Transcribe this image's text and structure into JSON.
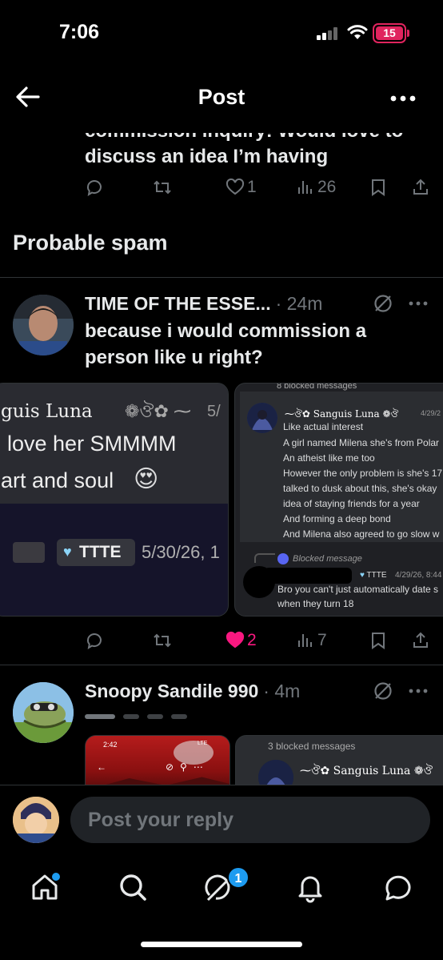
{
  "status": {
    "time": "7:06",
    "battery": "15"
  },
  "topbar": {
    "title": "Post"
  },
  "prev_post": {
    "text_line1": "commission inquiry! Would love to",
    "text_line2": "discuss an idea I’m having",
    "likes": "1",
    "views": "26"
  },
  "section": {
    "heading": "Probable spam"
  },
  "post1": {
    "name": "TIME OF THE ESSE...",
    "meta": "· 24m",
    "text_line1": "because i would commission a",
    "text_line2": "person like u right?",
    "likes": "2",
    "views": "7",
    "media1": {
      "user": "guis Luna",
      "user_suffix": "5/",
      "line1": "love her SMMMM",
      "line2": "art and soul",
      "tag": "TTTE",
      "date": "5/30/26, 1"
    },
    "media2": {
      "header": "8 blocked messages",
      "user": "Sanguis Luna",
      "date": "4/29/2",
      "lines": [
        "Like actual interest",
        "A girl named Milena she's from Polar",
        "An atheist like me too",
        "However the only problem is she's 17",
        "talked to dusk about this, she's okay",
        "idea of staying friends for a year",
        "And forming a deep bond",
        "And Milena also agreed to go slow w"
      ],
      "blocked_label": "Blocked message",
      "tag": "TTTE",
      "date2": "4/29/26, 8:44 A",
      "reply_line1": "Bro you can't just automatically date s",
      "reply_line2": "when they turn 18"
    }
  },
  "post2": {
    "name": "Snoopy Sandile 990",
    "meta": "· 4m",
    "media1": {
      "time": "2:42",
      "net": "LTE"
    },
    "media2": {
      "header": "3 blocked messages",
      "user": "Sanguis Luna"
    }
  },
  "reply": {
    "placeholder": "Post your reply"
  },
  "nav": {
    "badge": "1"
  },
  "colors": {
    "accent": "#1d9bf0",
    "like": "#f91880",
    "muted": "#71767b"
  }
}
